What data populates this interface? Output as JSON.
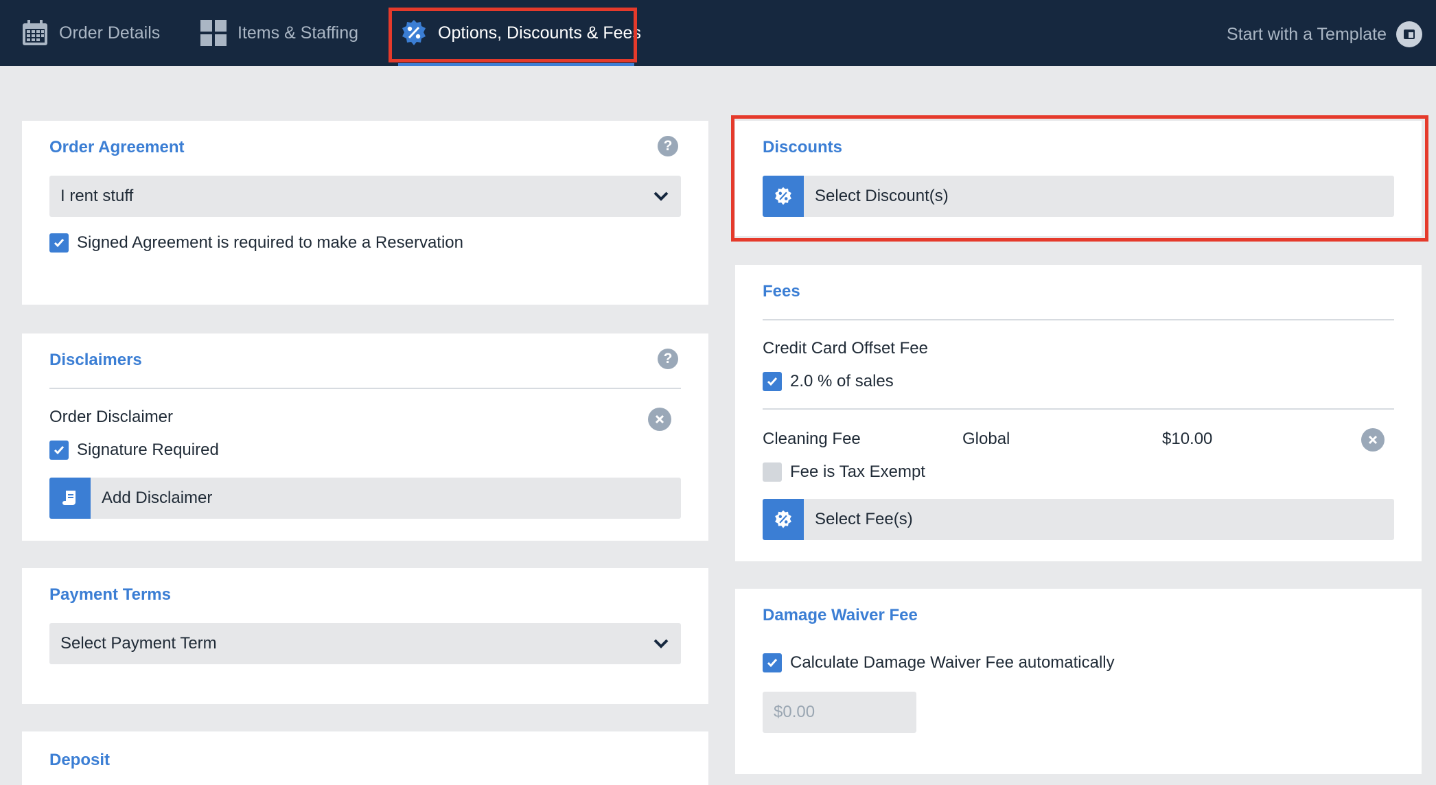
{
  "nav": {
    "tabs": [
      {
        "label": "Order Details",
        "icon": "calendar-icon"
      },
      {
        "label": "Items & Staffing",
        "icon": "grid-icon"
      },
      {
        "label": "Options, Discounts & Fees",
        "icon": "discount-badge-icon"
      }
    ],
    "active_tab": "Options, Discounts & Fees",
    "template_link": {
      "label": "Start with a Template",
      "icon": "template-icon"
    }
  },
  "order_agreement": {
    "title": "Order Agreement",
    "selected": "I rent stuff",
    "signed_required": {
      "label": "Signed Agreement is required to make a Reservation",
      "checked": true
    }
  },
  "disclaimers": {
    "title": "Disclaimers",
    "item": {
      "name": "Order Disclaimer",
      "signature": {
        "label": "Signature Required",
        "checked": true
      }
    },
    "add_label": "Add Disclaimer"
  },
  "payment_terms": {
    "title": "Payment Terms",
    "selected": "Select Payment Term"
  },
  "deposit": {
    "title": "Deposit"
  },
  "discounts": {
    "title": "Discounts",
    "select_label": "Select Discount(s)"
  },
  "fees": {
    "title": "Fees",
    "credit_card": {
      "name": "Credit Card Offset Fee",
      "option": {
        "label": "2.0 % of sales",
        "checked": true
      }
    },
    "cleaning": {
      "name": "Cleaning Fee",
      "scope": "Global",
      "amount": "$10.00",
      "tax_exempt": {
        "label": "Fee is Tax Exempt",
        "checked": false
      }
    },
    "select_label": "Select Fee(s)"
  },
  "damage_waiver": {
    "title": "Damage Waiver Fee",
    "auto_calc": {
      "label": "Calculate Damage Waiver Fee automatically",
      "checked": true
    },
    "amount_placeholder": "$0.00"
  },
  "colors": {
    "nav_bg": "#16283f",
    "accent": "#3b7ed4",
    "highlight": "#e53a2b"
  }
}
